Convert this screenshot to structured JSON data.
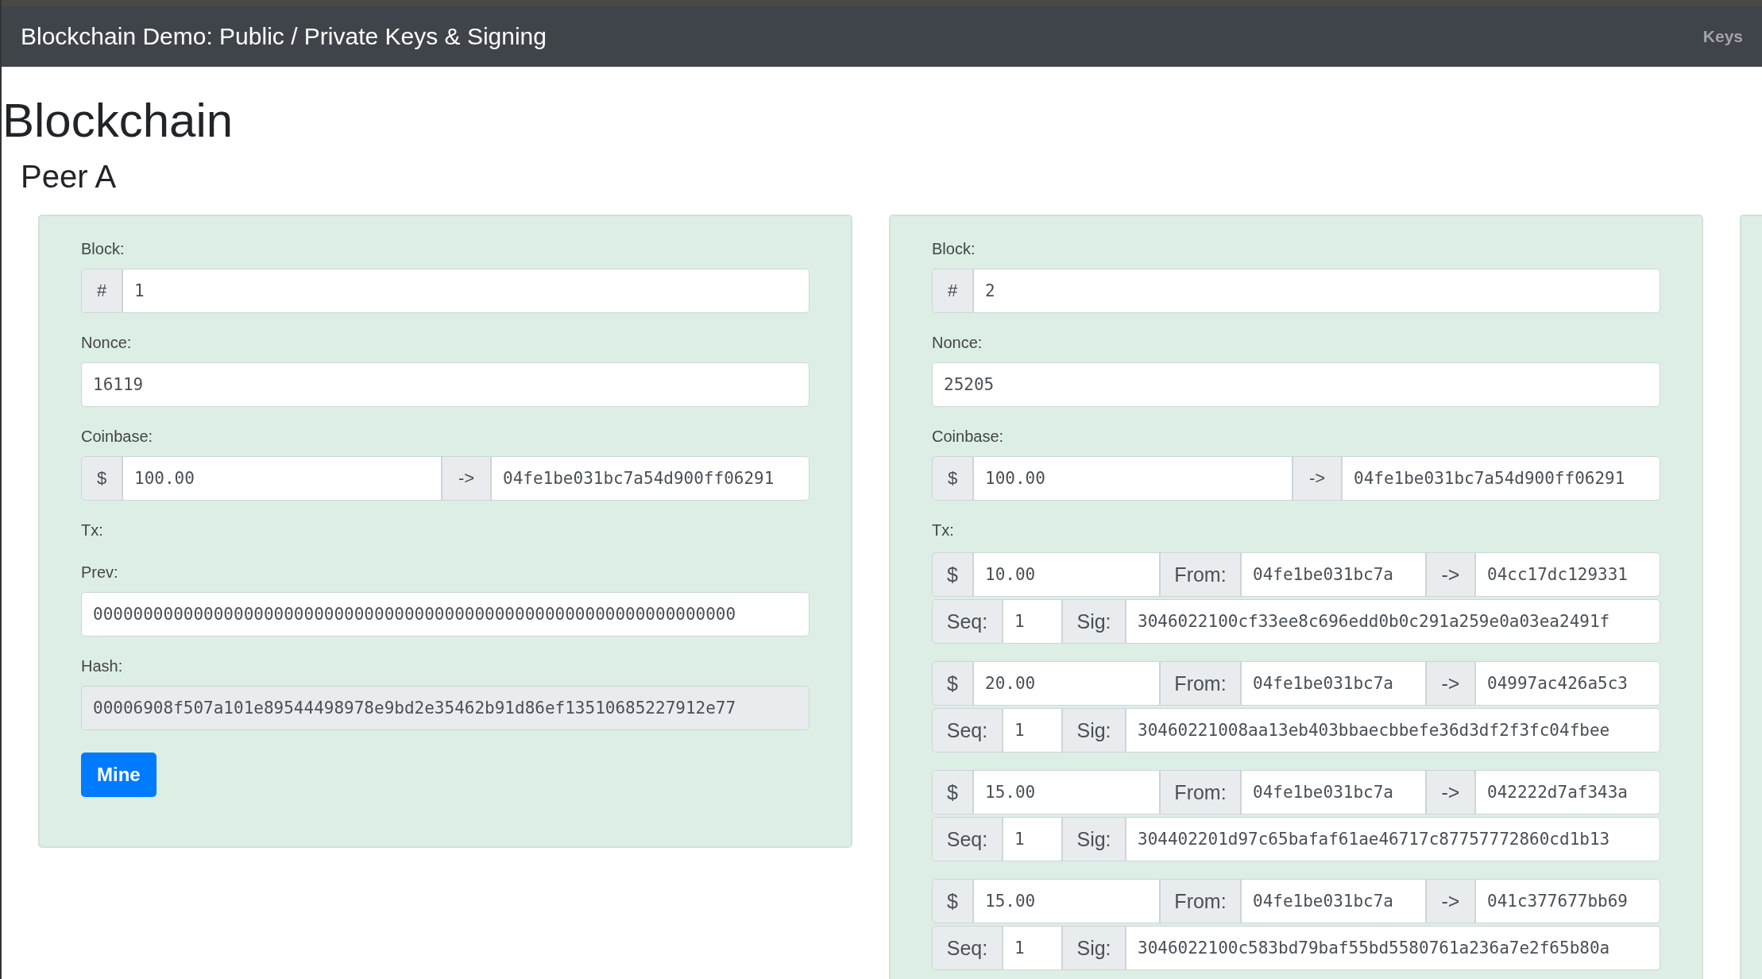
{
  "navbar": {
    "title": "Blockchain Demo: Public / Private Keys & Signing",
    "link": "Keys"
  },
  "heading": "Blockchain",
  "peer": "Peer A",
  "blocks": [
    {
      "block_label": "Block:",
      "hash_sign": "#",
      "number": "1",
      "nonce_label": "Nonce:",
      "nonce": "16119",
      "coinbase_label": "Coinbase:",
      "coinbase": {
        "currency": "$",
        "amount": "100.00",
        "arrow": "->",
        "to": "04fe1be031bc7a54d900ff06291"
      },
      "tx_label": "Tx:",
      "prev_label": "Prev:",
      "prev": "0000000000000000000000000000000000000000000000000000000000000000",
      "hash_label": "Hash:",
      "hash": "00006908f507a101e89544498978e9bd2e35462b91d86ef13510685227912e77",
      "button": "Mine"
    },
    {
      "block_label": "Block:",
      "hash_sign": "#",
      "number": "2",
      "nonce_label": "Nonce:",
      "nonce": "25205",
      "coinbase_label": "Coinbase:",
      "coinbase": {
        "currency": "$",
        "amount": "100.00",
        "arrow": "->",
        "to": "04fe1be031bc7a54d900ff06291"
      },
      "tx_label": "Tx:",
      "txs": [
        {
          "currency": "$",
          "amount": "10.00",
          "from_label": "From:",
          "from": "04fe1be031bc7a",
          "arrow": "->",
          "to": "04cc17dc129331",
          "seq_label": "Seq:",
          "seq": "1",
          "sig_label": "Sig:",
          "sig": "3046022100cf33ee8c696edd0b0c291a259e0a03ea2491f"
        },
        {
          "currency": "$",
          "amount": "20.00",
          "from_label": "From:",
          "from": "04fe1be031bc7a",
          "arrow": "->",
          "to": "04997ac426a5c3",
          "seq_label": "Seq:",
          "seq": "1",
          "sig_label": "Sig:",
          "sig": "30460221008aa13eb403bbaecbbefe36d3df2f3fc04fbee"
        },
        {
          "currency": "$",
          "amount": "15.00",
          "from_label": "From:",
          "from": "04fe1be031bc7a",
          "arrow": "->",
          "to": "042222d7af343a",
          "seq_label": "Seq:",
          "seq": "1",
          "sig_label": "Sig:",
          "sig": "304402201d97c65bafaf61ae46717c87757772860cd1b13"
        },
        {
          "currency": "$",
          "amount": "15.00",
          "from_label": "From:",
          "from": "04fe1be031bc7a",
          "arrow": "->",
          "to": "041c377677bb69",
          "seq_label": "Seq:",
          "seq": "1",
          "sig_label": "Sig:",
          "sig": "3046022100c583bd79baf55bd5580761a236a7e2f65b80a"
        }
      ]
    }
  ]
}
